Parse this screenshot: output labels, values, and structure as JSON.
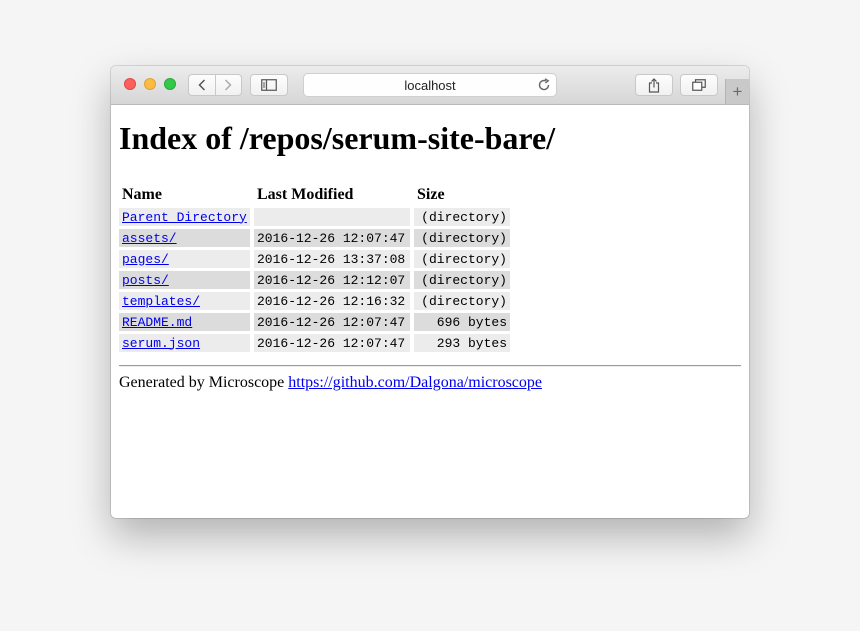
{
  "browser": {
    "address": "localhost",
    "new_tab_label": "+"
  },
  "page": {
    "title": "Index of /repos/serum-site-bare/",
    "columns": {
      "name": "Name",
      "modified": "Last Modified",
      "size": "Size"
    },
    "rows": [
      {
        "name": "Parent Directory",
        "modified": "",
        "size": "(directory)"
      },
      {
        "name": "assets/",
        "modified": "2016-12-26 12:07:47",
        "size": "(directory)"
      },
      {
        "name": "pages/",
        "modified": "2016-12-26 13:37:08",
        "size": "(directory)"
      },
      {
        "name": "posts/",
        "modified": "2016-12-26 12:12:07",
        "size": "(directory)"
      },
      {
        "name": "templates/",
        "modified": "2016-12-26 12:16:32",
        "size": "(directory)"
      },
      {
        "name": "README.md",
        "modified": "2016-12-26 12:07:47",
        "size": "696 bytes"
      },
      {
        "name": "serum.json",
        "modified": "2016-12-26 12:07:47",
        "size": "293 bytes"
      }
    ],
    "footer": {
      "text": "Generated by Microscope",
      "link": "https://github.com/Dalgona/microscope"
    }
  },
  "colors": {
    "link": "#0000ee",
    "row_odd": "#ececec",
    "row_even": "#dcdcdc",
    "close": "#fc605c",
    "minimize": "#fdbc40",
    "zoom": "#34c84a"
  },
  "icons": [
    "back-icon",
    "forward-icon",
    "sidebar-icon",
    "reload-icon",
    "share-icon",
    "tabs-overview-icon"
  ]
}
